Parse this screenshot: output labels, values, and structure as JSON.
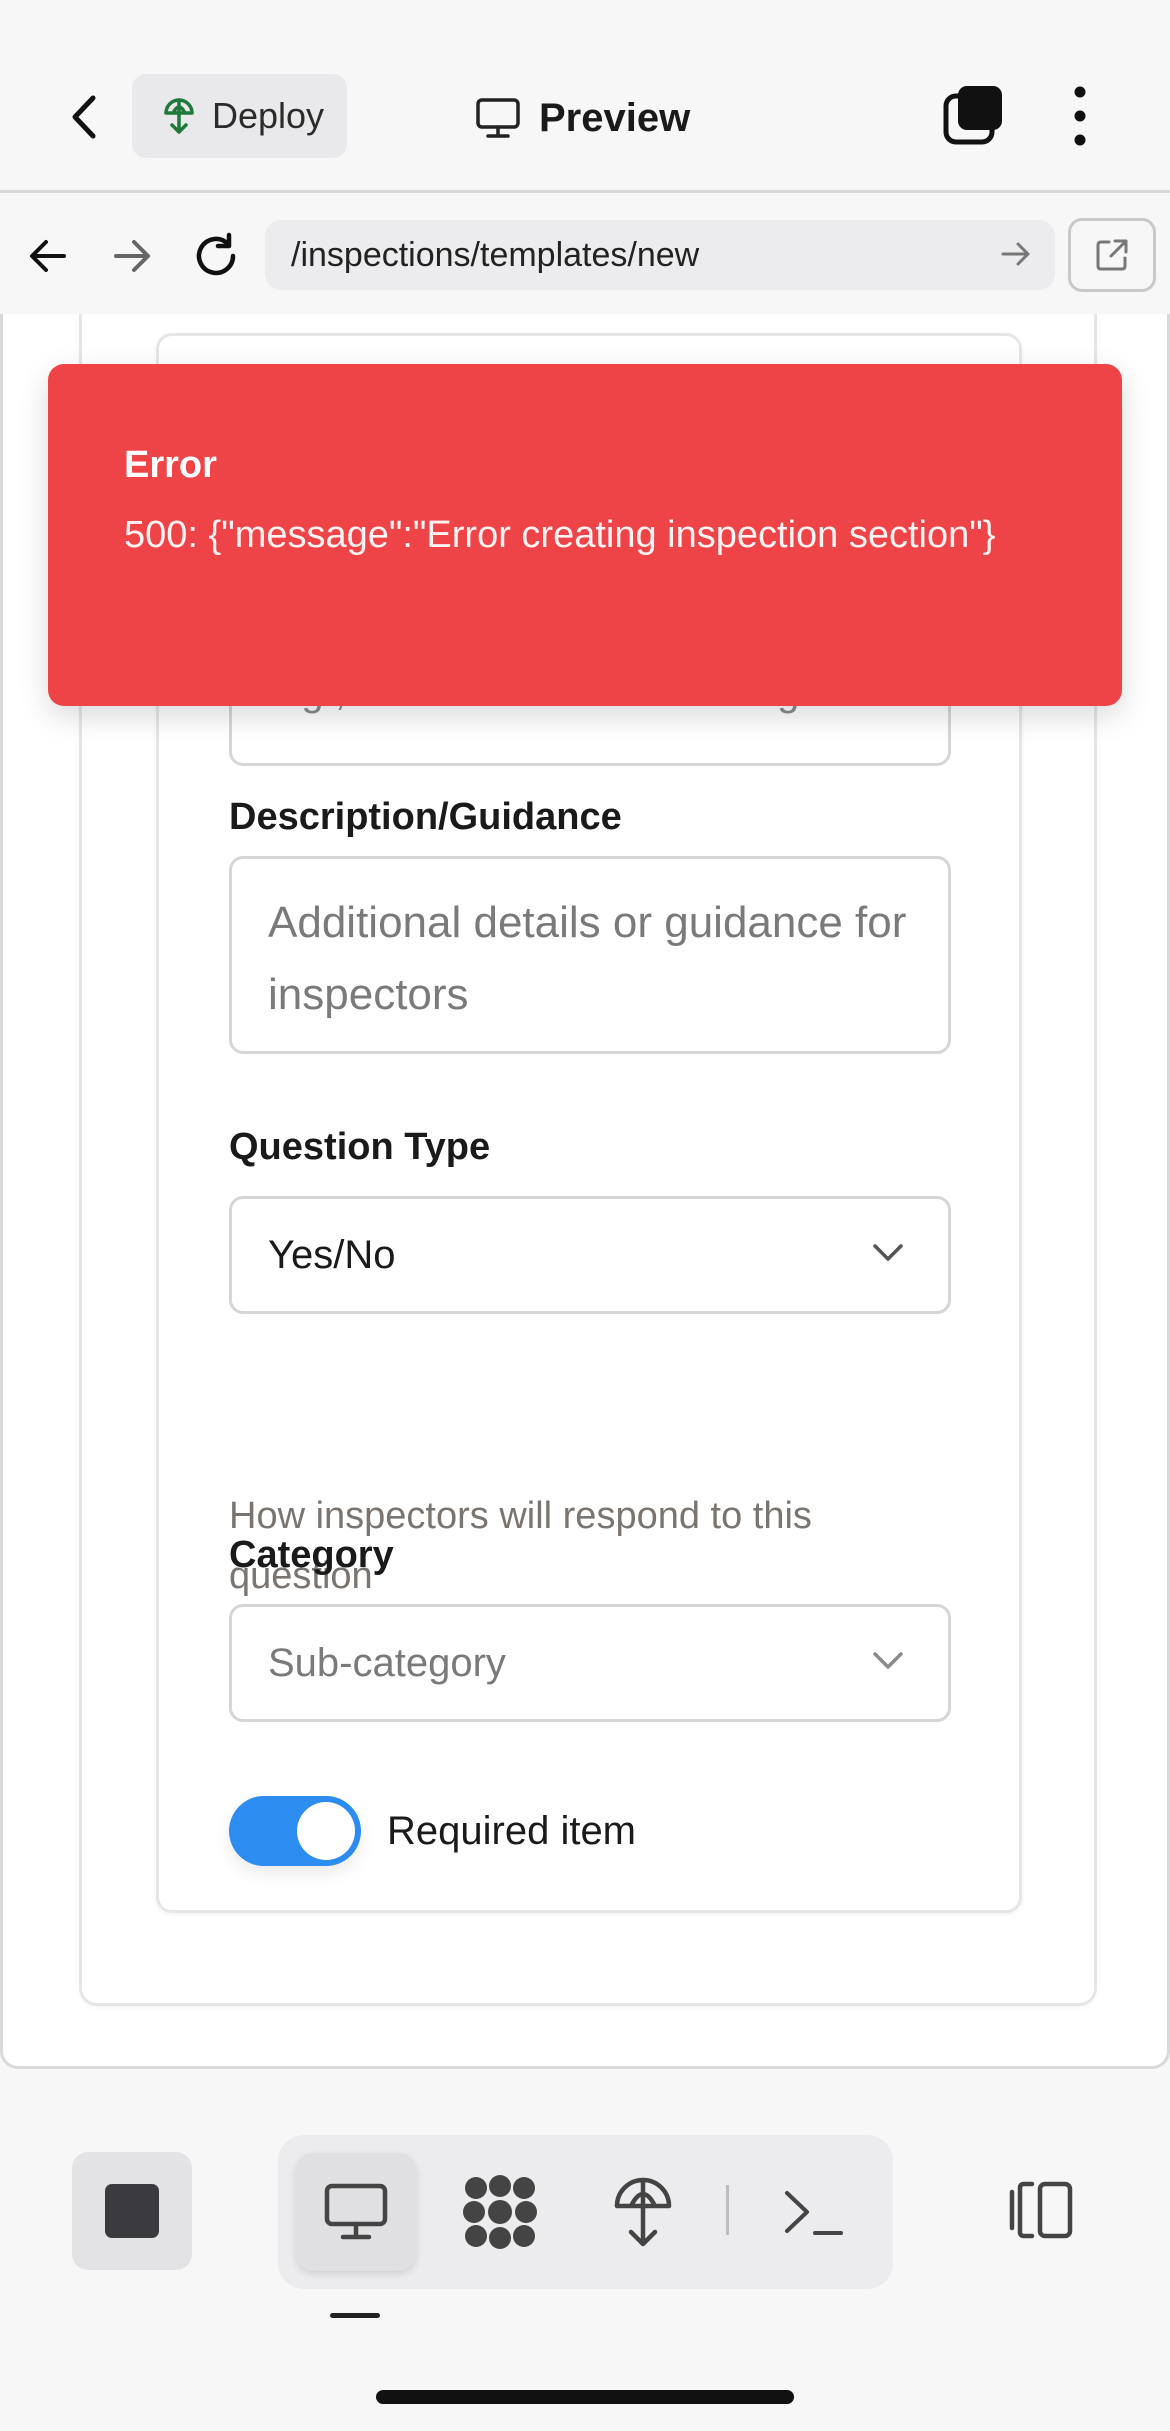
{
  "header": {
    "deploy_label": "Deploy",
    "preview_label": "Preview"
  },
  "browser": {
    "url": "/inspections/templates/new"
  },
  "form": {
    "partial_placeholder": "e.g., Check that the fire extinguisher is present and inspected",
    "description_label": "Description/Guidance",
    "description_placeholder": "Additional details or guidance for inspectors",
    "question_type_label": "Question Type",
    "question_type_value": "Yes/No",
    "question_type_helper": "How inspectors will respond to this question",
    "category_label": "Category",
    "category_placeholder": "Sub-category",
    "required_label": "Required item",
    "required_on": true
  },
  "toast": {
    "title": "Error",
    "message": "500: {\"message\":\"Error creating inspection section\"}",
    "color": "#ef4447"
  },
  "dock": {
    "items": [
      "monitor-icon",
      "apps-icon",
      "deploy-icon",
      "terminal-icon"
    ],
    "accent": "#2d8cf0"
  }
}
